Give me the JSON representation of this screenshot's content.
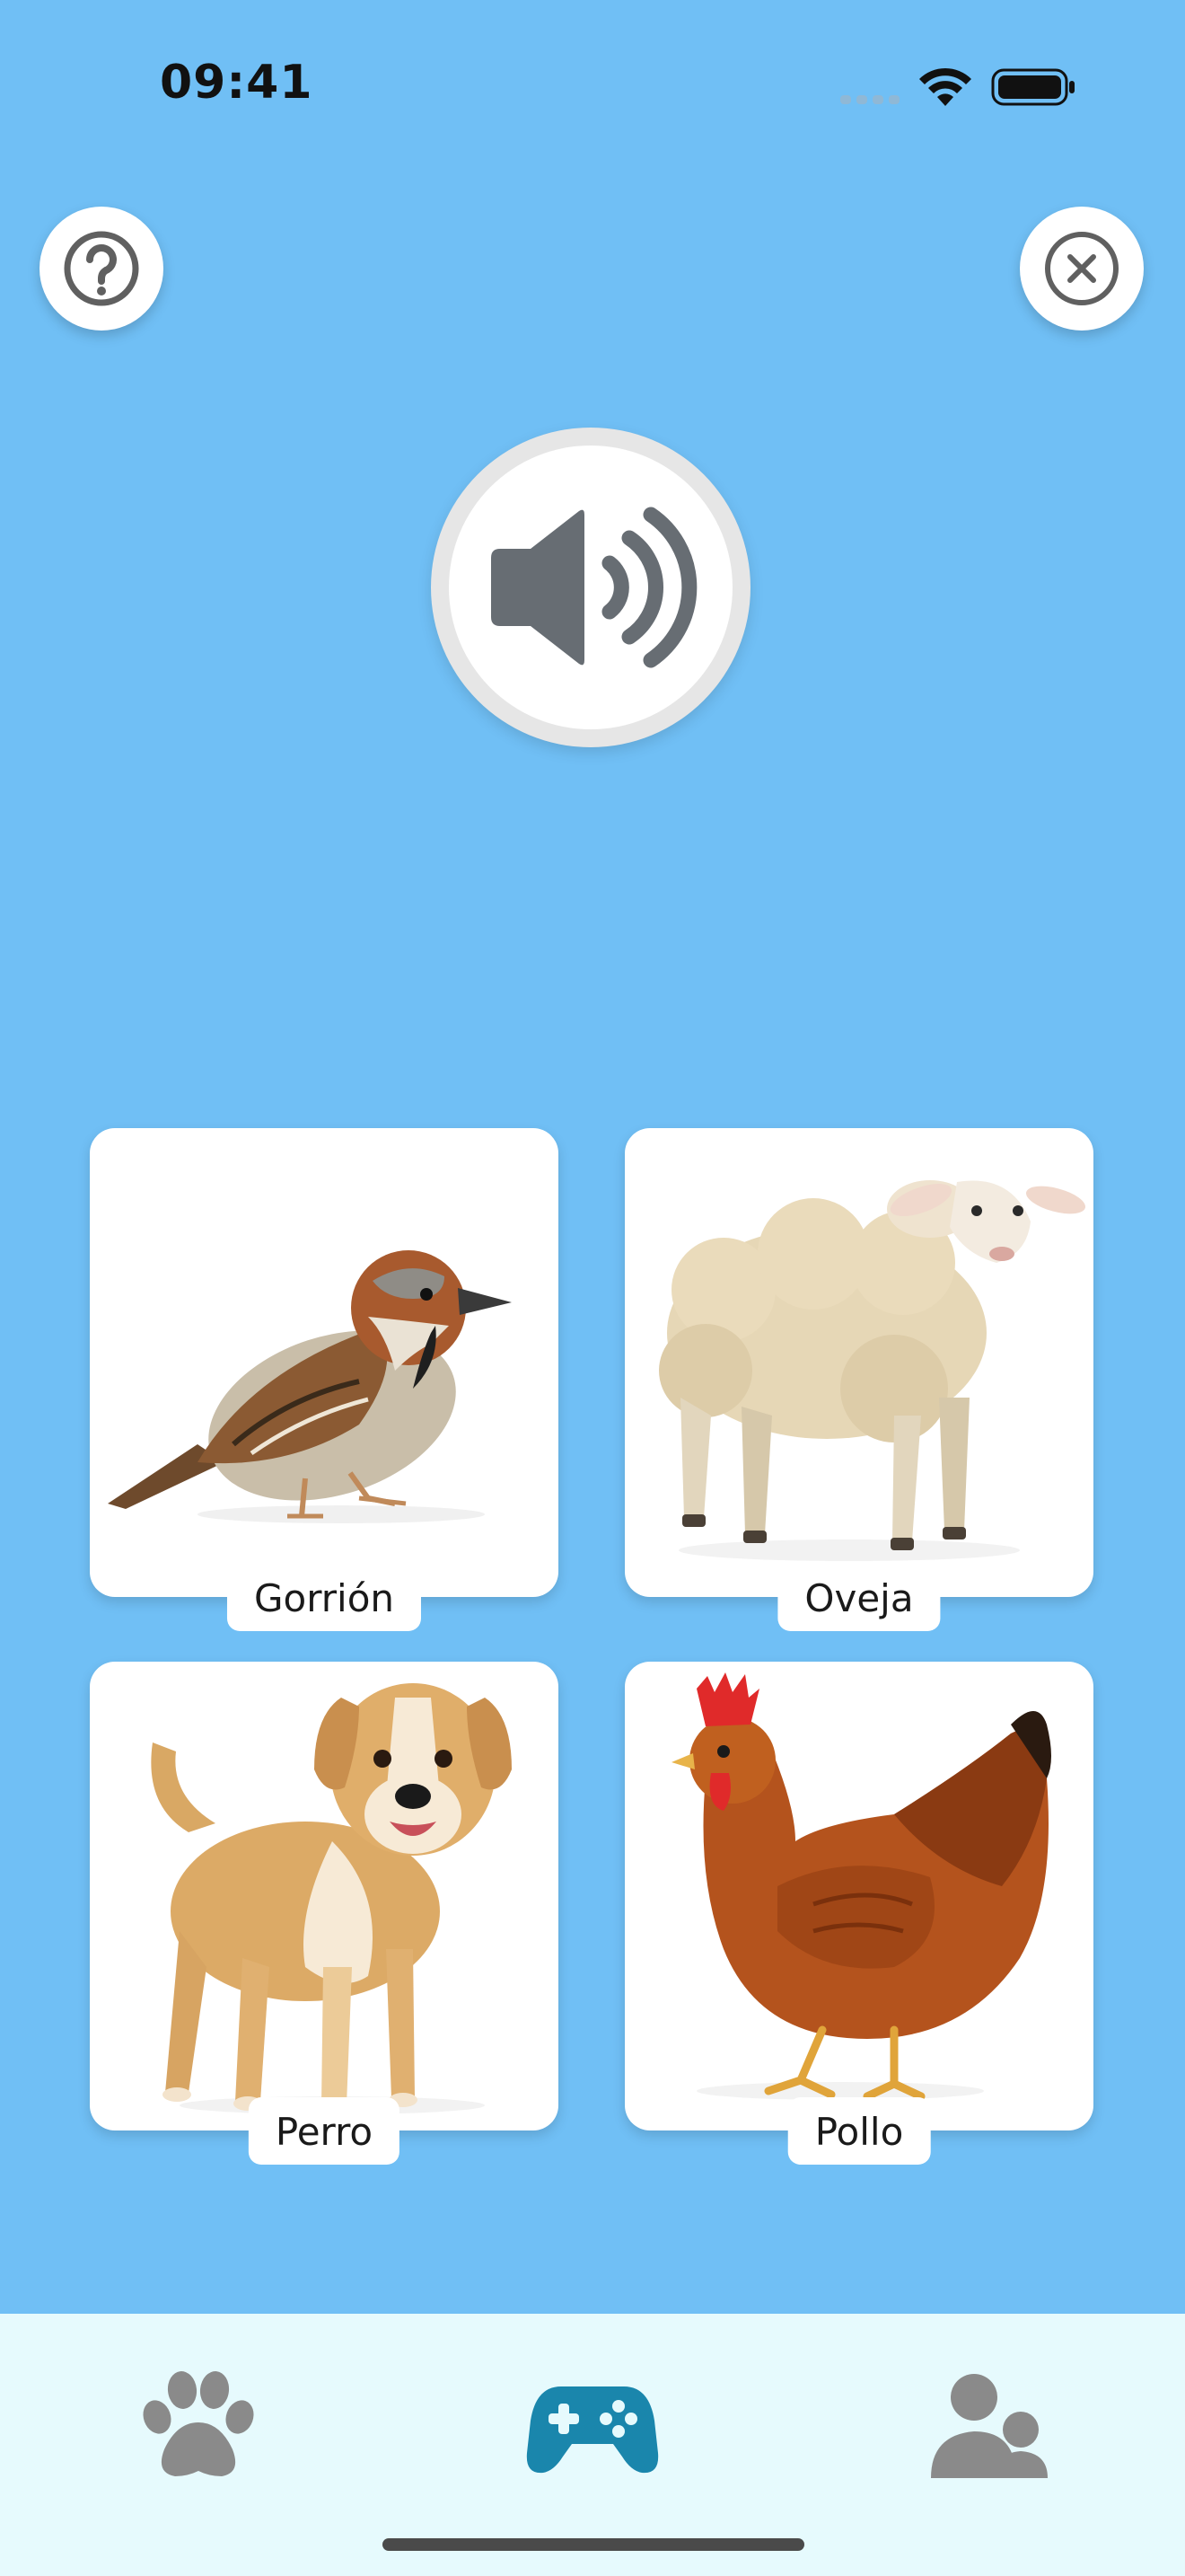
{
  "status_bar": {
    "time": "09:41"
  },
  "buttons": {
    "help_icon": "question-circle-icon",
    "close_icon": "close-circle-icon",
    "sound_icon": "speaker-wave-icon"
  },
  "cards": [
    {
      "label": "Gorrión",
      "image": "sparrow"
    },
    {
      "label": "Oveja",
      "image": "sheep"
    },
    {
      "label": "Perro",
      "image": "dog"
    },
    {
      "label": "Pollo",
      "image": "chicken"
    }
  ],
  "tab_bar": {
    "tabs": [
      {
        "name": "animals",
        "icon": "paw-icon",
        "active": false
      },
      {
        "name": "games",
        "icon": "gamepad-icon",
        "active": true
      },
      {
        "name": "profile",
        "icon": "users-icon",
        "active": false
      }
    ]
  },
  "colors": {
    "background": "#70bff5",
    "tab_bar": "#e6fafd",
    "active_tab": "#1a86ac",
    "inactive_tab": "#8a8a8a",
    "icon_gray": "#606060"
  }
}
